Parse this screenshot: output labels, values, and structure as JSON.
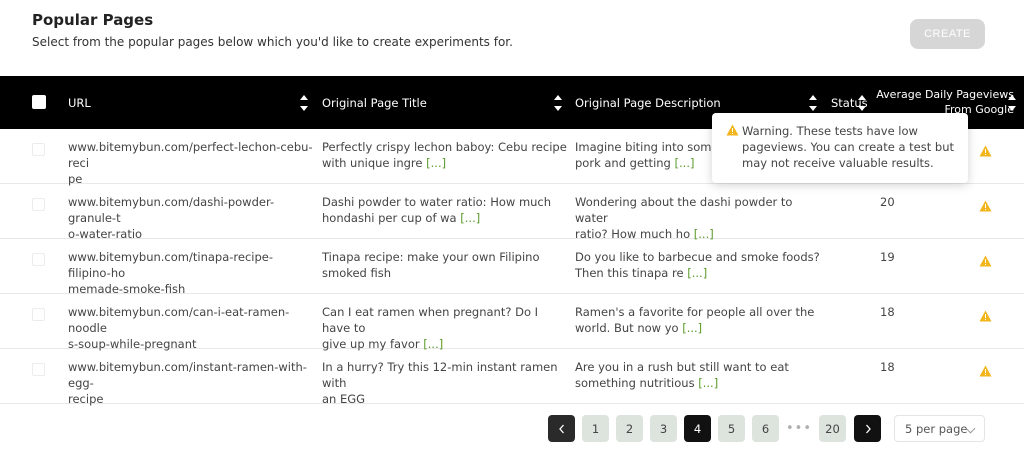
{
  "header": {
    "title": "Popular Pages",
    "subtitle": "Select from the popular pages below which you'd like to create experiments for.",
    "create_label": "CREATE"
  },
  "table": {
    "columns": {
      "url": "URL",
      "title": "Original Page Title",
      "description": "Original Page Description",
      "status": "Status",
      "avg_line1": "Average Daily Pageviews",
      "avg_line2": "From Google"
    },
    "more_label": "[...]",
    "rows": [
      {
        "url1": "www.bitemybun.com/perfect-lechon-cebu-reci",
        "url2": "pe",
        "title1": "Perfectly crispy lechon baboy: Cebu recipe",
        "title2": "with unique ingre",
        "desc1": "Imagine biting into some p",
        "desc2": "pork and getting",
        "pageviews": ""
      },
      {
        "url1": "www.bitemybun.com/dashi-powder-granule-t",
        "url2": "o-water-ratio",
        "title1": "Dashi powder to water ratio: How much",
        "title2": "hondashi per cup of wa",
        "desc1": "Wondering about the dashi powder to water",
        "desc2": "ratio? How much ho",
        "pageviews": "20"
      },
      {
        "url1": "www.bitemybun.com/tinapa-recipe-filipino-ho",
        "url2": "memade-smoke-fish",
        "title1": "Tinapa recipe: make your own Filipino",
        "title2": "smoked fish",
        "desc1": "Do you like to barbecue and smoke foods?",
        "desc2": "Then this tinapa re",
        "pageviews": "19"
      },
      {
        "url1": "www.bitemybun.com/can-i-eat-ramen-noodle",
        "url2": "s-soup-while-pregnant",
        "title1": "Can I eat ramen when pregnant? Do I have to",
        "title2": "give up my favor",
        "desc1": "Ramen's a favorite for people all over the",
        "desc2": "world. But now yo",
        "pageviews": "18"
      },
      {
        "url1": "www.bitemybun.com/instant-ramen-with-egg-",
        "url2": "recipe",
        "title1": "In a hurry? Try this 12-min instant ramen with",
        "title2": "an EGG",
        "desc1": "Are you in a rush but still want to eat",
        "desc2": "something nutritious",
        "pageviews": "18"
      }
    ]
  },
  "tooltip": {
    "line1": "Warning. These tests have low",
    "line2": "pageviews. You can create a test but",
    "line3": "may not receive valuable results."
  },
  "pagination": {
    "pages": [
      "1",
      "2",
      "3",
      "4",
      "5",
      "6",
      "20"
    ],
    "current": "4",
    "ellipsis": "•••",
    "per_page": "5 per page"
  },
  "colors": {
    "header_bg": "#000000",
    "warning": "#f2b51c",
    "more_link": "#5a9a2a",
    "create_disabled": "#d6d6d6"
  },
  "icons": [
    "checkbox",
    "sort-icon",
    "warning-icon",
    "chevron-left-icon",
    "chevron-right-icon",
    "chevron-down-icon"
  ]
}
